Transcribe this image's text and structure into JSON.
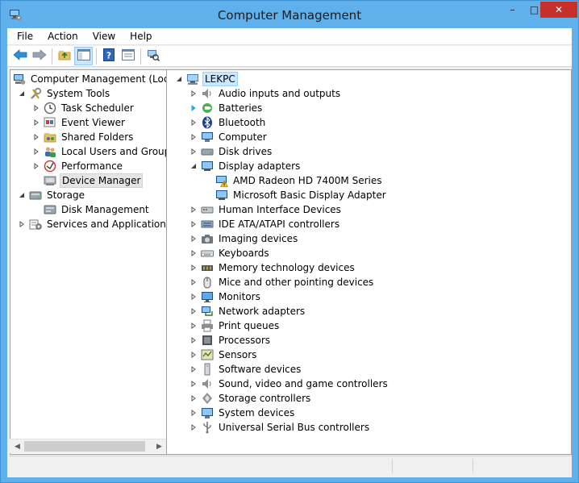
{
  "window": {
    "title": "Computer Management",
    "controls": {
      "minimize": "–",
      "maximize": "□",
      "close": "✕"
    }
  },
  "menubar": [
    "File",
    "Action",
    "View",
    "Help"
  ],
  "toolbar": {
    "buttons": [
      "back-icon",
      "forward-icon",
      "up-folder-icon",
      "show-hide-console-tree-icon",
      "help-icon",
      "properties-icon",
      "scan-hardware-icon"
    ]
  },
  "tree": {
    "root": "Computer Management (Local",
    "items": [
      {
        "label": "System Tools",
        "icon": "tools-icon",
        "level": 1,
        "expanded": true
      },
      {
        "label": "Task Scheduler",
        "icon": "clock-icon",
        "level": 2,
        "expanded": false
      },
      {
        "label": "Event Viewer",
        "icon": "event-viewer-icon",
        "level": 2,
        "expanded": false
      },
      {
        "label": "Shared Folders",
        "icon": "shared-folder-icon",
        "level": 2,
        "expanded": false
      },
      {
        "label": "Local Users and Groups",
        "icon": "users-icon",
        "level": 2,
        "expanded": false
      },
      {
        "label": "Performance",
        "icon": "performance-icon",
        "level": 2,
        "expanded": false
      },
      {
        "label": "Device Manager",
        "icon": "device-manager-icon",
        "level": 2,
        "selected": true
      },
      {
        "label": "Storage",
        "icon": "storage-icon",
        "level": 1,
        "expanded": true
      },
      {
        "label": "Disk Management",
        "icon": "disk-management-icon",
        "level": 2
      },
      {
        "label": "Services and Applications",
        "icon": "services-icon",
        "level": 1,
        "expanded": false
      }
    ]
  },
  "devices": {
    "root": "LEKPC",
    "items": [
      {
        "label": "Audio inputs and outputs",
        "icon": "speaker-icon"
      },
      {
        "label": "Batteries",
        "icon": "battery-icon"
      },
      {
        "label": "Bluetooth",
        "icon": "bluetooth-icon"
      },
      {
        "label": "Computer",
        "icon": "computer-icon"
      },
      {
        "label": "Disk drives",
        "icon": "disk-drive-icon"
      },
      {
        "label": "Display adapters",
        "icon": "display-adapter-icon",
        "expanded": true,
        "children": [
          {
            "label": "AMD Radeon HD 7400M Series",
            "icon": "display-warning-icon"
          },
          {
            "label": "Microsoft Basic Display Adapter",
            "icon": "display-adapter-icon"
          }
        ]
      },
      {
        "label": "Human Interface Devices",
        "icon": "hid-icon"
      },
      {
        "label": "IDE ATA/ATAPI controllers",
        "icon": "ide-controller-icon"
      },
      {
        "label": "Imaging devices",
        "icon": "camera-icon"
      },
      {
        "label": "Keyboards",
        "icon": "keyboard-icon"
      },
      {
        "label": "Memory technology devices",
        "icon": "memory-icon"
      },
      {
        "label": "Mice and other pointing devices",
        "icon": "mouse-icon"
      },
      {
        "label": "Monitors",
        "icon": "monitor-icon"
      },
      {
        "label": "Network adapters",
        "icon": "network-adapter-icon"
      },
      {
        "label": "Print queues",
        "icon": "printer-icon"
      },
      {
        "label": "Processors",
        "icon": "processor-icon"
      },
      {
        "label": "Sensors",
        "icon": "sensor-icon"
      },
      {
        "label": "Software devices",
        "icon": "software-device-icon"
      },
      {
        "label": "Sound, video and game controllers",
        "icon": "sound-icon"
      },
      {
        "label": "Storage controllers",
        "icon": "storage-controller-icon"
      },
      {
        "label": "System devices",
        "icon": "system-devices-icon"
      },
      {
        "label": "Universal Serial Bus controllers",
        "icon": "usb-icon"
      }
    ]
  }
}
